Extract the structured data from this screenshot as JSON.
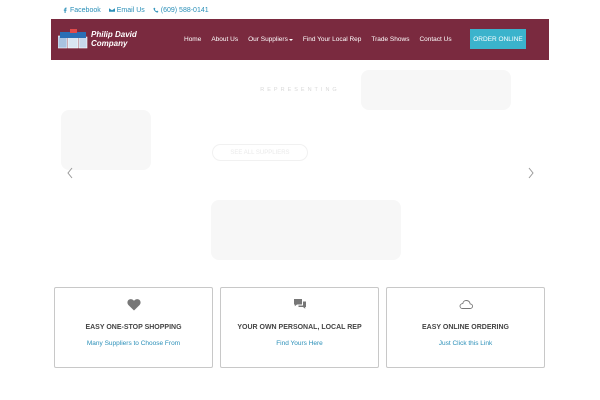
{
  "topbar": {
    "facebook": "Facebook",
    "email": "Email Us",
    "phone": "(609) 588-0141"
  },
  "brand": {
    "line1": "Philip David",
    "line2": "Company",
    "mark": "PDC",
    "color": "#7a2a3f"
  },
  "nav": {
    "items": [
      "Home",
      "About Us",
      "Our Suppliers",
      "Find Your Local Rep",
      "Trade Shows",
      "Contact Us"
    ],
    "cta": "ORDER ONLINE",
    "cta_color": "#3bb3cc"
  },
  "hero": {
    "kicker": "REPRESENTING",
    "button": "SEE ALL SUPPLIERS"
  },
  "features": [
    {
      "icon": "heart-icon",
      "title": "EASY ONE-STOP SHOPPING",
      "link": "Many Suppliers to Choose From"
    },
    {
      "icon": "chat-bubbles-icon",
      "title": "YOUR OWN PERSONAL, LOCAL REP",
      "link": "Find Yours Here"
    },
    {
      "icon": "cloud-icon",
      "title": "EASY ONLINE ORDERING",
      "link": "Just Click this Link"
    }
  ]
}
